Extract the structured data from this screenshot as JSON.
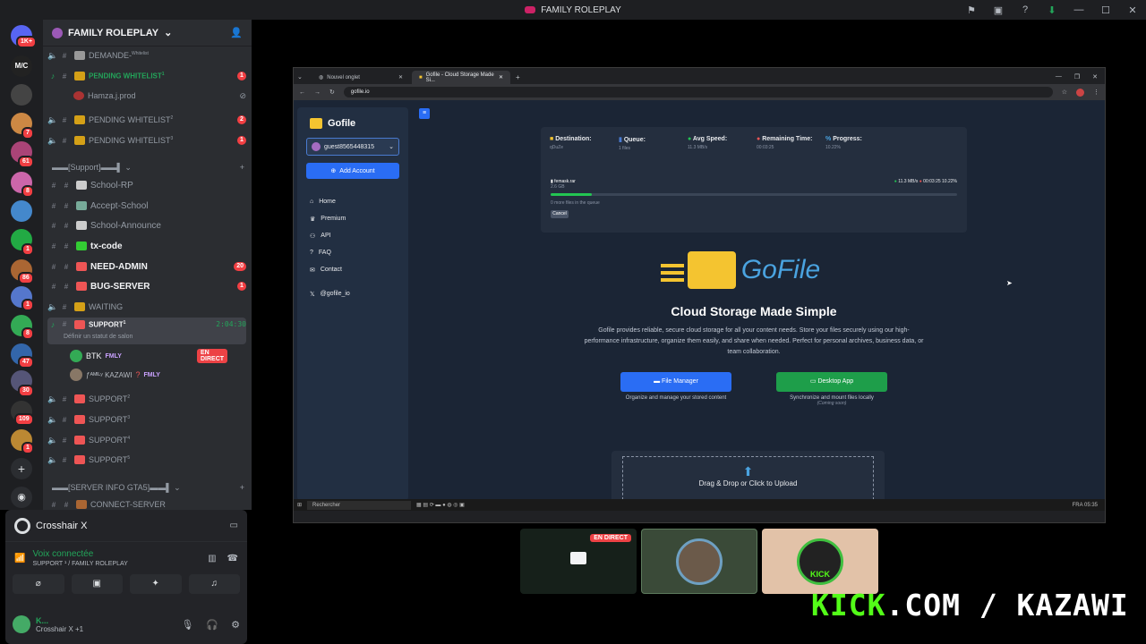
{
  "window": {
    "title": "FAMILY ROLEPLAY"
  },
  "rail": {
    "badges": [
      "1K+",
      "7",
      "61",
      "8",
      "1",
      "86",
      "1",
      "8",
      "47",
      "30",
      "109",
      "1"
    ],
    "logo_text": "M/C"
  },
  "guild": {
    "name": "FAMILY ROLEPLAY"
  },
  "channels": [
    {
      "name": "DEMANDE-",
      "sup": "Whitelist"
    },
    {
      "name": "PENDING WHITELIST",
      "sup": "1",
      "count": "1"
    },
    {
      "name": "Hamza.j.prod"
    },
    {
      "name": "PENDING WHITELIST",
      "sup": "2",
      "count": "2"
    },
    {
      "name": "PENDING WHITELIST",
      "sup": "3",
      "count": "1"
    }
  ],
  "cat_support": "[Support]",
  "support_channels": [
    {
      "name": "School-RP"
    },
    {
      "name": "Accept-School"
    },
    {
      "name": "School-Announce"
    },
    {
      "name": "tx-code"
    },
    {
      "name": "NEED-ADMIN",
      "count": "20"
    },
    {
      "name": "BUG-SERVER",
      "count": "1"
    },
    {
      "name": "WAITING"
    }
  ],
  "active_channel": {
    "name": "SUPPORT",
    "sup": "1",
    "timer": "2:04:30",
    "status": "Définir un statut de salon"
  },
  "voice_users": [
    {
      "name": "BTK",
      "tag": "FMLY",
      "live": "EN DIRECT"
    },
    {
      "name": "ƒᴬᴹᴵᴸʸ KAZAWI",
      "tag": "FMLY"
    }
  ],
  "more_support": [
    {
      "name": "SUPPORT",
      "sup": "2"
    },
    {
      "name": "SUPPORT",
      "sup": "3"
    },
    {
      "name": "SUPPORT",
      "sup": "4"
    },
    {
      "name": "SUPPORT",
      "sup": "5"
    }
  ],
  "cat_info": "[SERVER INFO GTA5]",
  "connect": "CONNECT-SERVER",
  "panel": {
    "activity": "Crosshair X",
    "voice_status": "Voix connectée",
    "voice_sub": "SUPPORT ¹ / FAMILY ROLEPLAY",
    "me_name": "K...",
    "me_status": "Crosshair X +1"
  },
  "browser": {
    "tabs": [
      "Nouvel onglet",
      "Gofile - Cloud Storage Made Si..."
    ],
    "url": "gofile.io"
  },
  "gofile": {
    "brand": "Gofile",
    "account": "guest8565448315",
    "add_account": "Add Account",
    "nav": [
      "Home",
      "Premium",
      "API",
      "FAQ",
      "Contact",
      "@gofile_io"
    ],
    "stats": [
      {
        "label": "Destination:",
        "value": "qDuZe"
      },
      {
        "label": "Queue:",
        "value": "1 files"
      },
      {
        "label": "Avg Speed:",
        "value": "11.3 MB/s"
      },
      {
        "label": "Remaining Time:",
        "value": "00:03:25"
      },
      {
        "label": "Progress:",
        "value": "10.22%"
      }
    ],
    "file_name": "femask.rar",
    "file_size": "2.6 GB",
    "file_speed": "11.3 MB/s",
    "file_eta": "00:03:25",
    "file_pct": "10.22%",
    "progress": 0.1022,
    "more_files": "0 more files in the queue",
    "cancel": "Cancel",
    "hero_word": "GoFile",
    "headline": "Cloud Storage Made Simple",
    "description": "Gofile provides reliable, secure cloud storage for all your content needs. Store your files securely using our high-performance infrastructure, organize them easily, and share when needed. Perfect for personal archives, business data, or team collaboration.",
    "btn_fm": "File Manager",
    "btn_fm_sub": "Organize and manage your stored content",
    "btn_da": "Desktop App",
    "btn_da_sub": "Synchronize and mount files locally",
    "btn_da_note": "(Coming soon)",
    "drop": "Drag & Drop or Click to Upload"
  },
  "taskbar": {
    "search": "Rechercher",
    "lang": "FRA",
    "time": "05:35"
  },
  "stream": {
    "live": "EN DIRECT",
    "kick": "KICK"
  },
  "overlay": {
    "kick_green": "KICK",
    "kick_rest": ".COM / KAZAWI"
  }
}
